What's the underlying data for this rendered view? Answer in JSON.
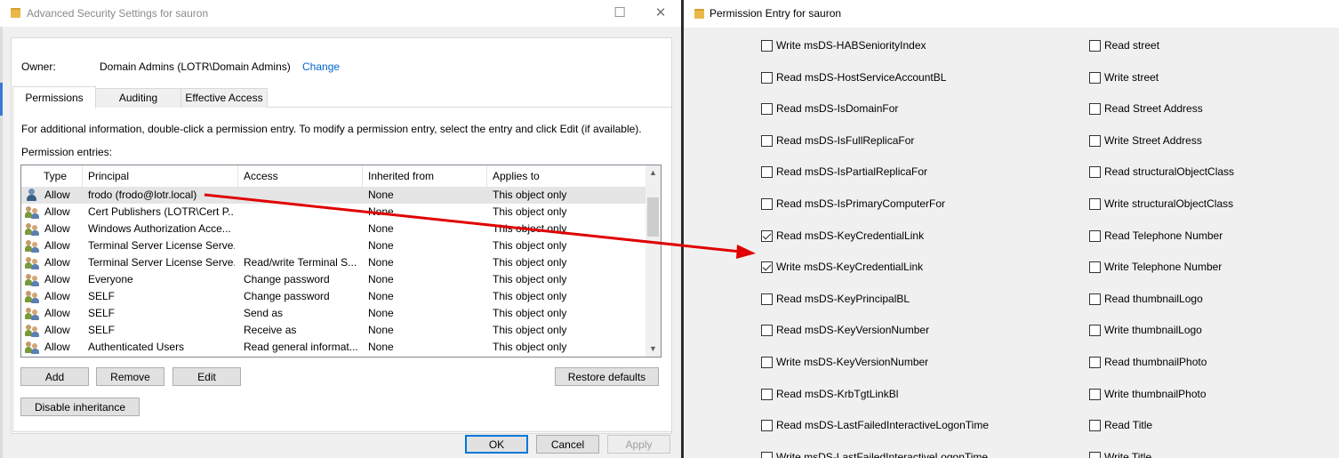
{
  "left_window": {
    "title": "Advanced Security Settings for sauron",
    "owner_label": "Owner:",
    "owner_value": "Domain Admins (LOTR\\Domain Admins)",
    "owner_change": "Change",
    "tabs": [
      "Permissions",
      "Auditing",
      "Effective Access"
    ],
    "info_text": "For additional information, double-click a permission entry. To modify a permission entry, select the entry and click Edit (if available).",
    "entries_label": "Permission entries:",
    "columns": [
      "Type",
      "Principal",
      "Access",
      "Inherited from",
      "Applies to"
    ],
    "rows": [
      {
        "icon": "user-icon",
        "type": "Allow",
        "principal": "frodo (frodo@lotr.local)",
        "access": "",
        "inherited": "None",
        "applies": "This object only"
      },
      {
        "icon": "group-icon",
        "type": "Allow",
        "principal": "Cert Publishers (LOTR\\Cert P...",
        "access": "",
        "inherited": "None",
        "applies": "This object only"
      },
      {
        "icon": "group-icon",
        "type": "Allow",
        "principal": "Windows Authorization Acce...",
        "access": "",
        "inherited": "None",
        "applies": "This object only"
      },
      {
        "icon": "group-icon",
        "type": "Allow",
        "principal": "Terminal Server License Serve...",
        "access": "",
        "inherited": "None",
        "applies": "This object only"
      },
      {
        "icon": "group-icon",
        "type": "Allow",
        "principal": "Terminal Server License Serve...",
        "access": "Read/write Terminal S...",
        "inherited": "None",
        "applies": "This object only"
      },
      {
        "icon": "group-icon",
        "type": "Allow",
        "principal": "Everyone",
        "access": "Change password",
        "inherited": "None",
        "applies": "This object only"
      },
      {
        "icon": "group-icon",
        "type": "Allow",
        "principal": "SELF",
        "access": "Change password",
        "inherited": "None",
        "applies": "This object only"
      },
      {
        "icon": "group-icon",
        "type": "Allow",
        "principal": "SELF",
        "access": "Send as",
        "inherited": "None",
        "applies": "This object only"
      },
      {
        "icon": "group-icon",
        "type": "Allow",
        "principal": "SELF",
        "access": "Receive as",
        "inherited": "None",
        "applies": "This object only"
      },
      {
        "icon": "group-icon",
        "type": "Allow",
        "principal": "Authenticated Users",
        "access": "Read general informat...",
        "inherited": "None",
        "applies": "This object only"
      }
    ],
    "buttons": {
      "add": "Add",
      "remove": "Remove",
      "edit": "Edit",
      "restore_defaults": "Restore defaults",
      "disable_inheritance": "Disable inheritance",
      "ok": "OK",
      "cancel": "Cancel",
      "apply": "Apply"
    }
  },
  "right_window": {
    "title": "Permission Entry for sauron",
    "left_column": [
      {
        "label": "Write msDS-HABSeniorityIndex",
        "checked": false
      },
      {
        "label": "Read msDS-HostServiceAccountBL",
        "checked": false
      },
      {
        "label": "Read msDS-IsDomainFor",
        "checked": false
      },
      {
        "label": "Read msDS-IsFullReplicaFor",
        "checked": false
      },
      {
        "label": "Read msDS-IsPartialReplicaFor",
        "checked": false
      },
      {
        "label": "Read msDS-IsPrimaryComputerFor",
        "checked": false
      },
      {
        "label": "Read msDS-KeyCredentialLink",
        "checked": true
      },
      {
        "label": "Write msDS-KeyCredentialLink",
        "checked": true
      },
      {
        "label": "Read msDS-KeyPrincipalBL",
        "checked": false
      },
      {
        "label": "Read msDS-KeyVersionNumber",
        "checked": false
      },
      {
        "label": "Write msDS-KeyVersionNumber",
        "checked": false
      },
      {
        "label": "Read msDS-KrbTgtLinkBl",
        "checked": false
      },
      {
        "label": "Read msDS-LastFailedInteractiveLogonTime",
        "checked": false
      },
      {
        "label": "Write msDS-LastFailedInteractiveLogonTime",
        "checked": false
      }
    ],
    "right_column": [
      {
        "label": "Read street",
        "checked": false
      },
      {
        "label": "Write street",
        "checked": false
      },
      {
        "label": "Read Street Address",
        "checked": false
      },
      {
        "label": "Write Street Address",
        "checked": false
      },
      {
        "label": "Read structuralObjectClass",
        "checked": false
      },
      {
        "label": "Write structuralObjectClass",
        "checked": false
      },
      {
        "label": "Read Telephone Number",
        "checked": false
      },
      {
        "label": "Write Telephone Number",
        "checked": false
      },
      {
        "label": "Read thumbnailLogo",
        "checked": false
      },
      {
        "label": "Write thumbnailLogo",
        "checked": false
      },
      {
        "label": "Read thumbnailPhoto",
        "checked": false
      },
      {
        "label": "Write thumbnailPhoto",
        "checked": false
      },
      {
        "label": "Read Title",
        "checked": false
      },
      {
        "label": "Write Title",
        "checked": false
      }
    ]
  },
  "annotation": {
    "arrow_color": "#e00000"
  }
}
